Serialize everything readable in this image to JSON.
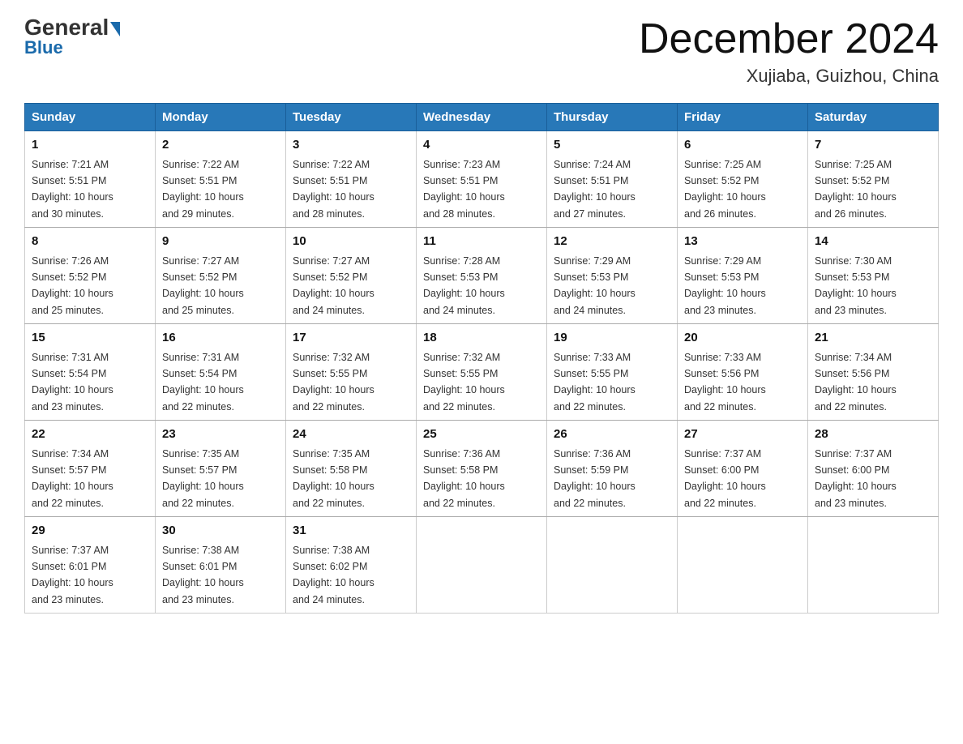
{
  "header": {
    "logo_line1": "General",
    "logo_line2": "Blue",
    "month_title": "December 2024",
    "location": "Xujiaba, Guizhou, China"
  },
  "days_of_week": [
    "Sunday",
    "Monday",
    "Tuesday",
    "Wednesday",
    "Thursday",
    "Friday",
    "Saturday"
  ],
  "weeks": [
    [
      {
        "day": "1",
        "sunrise": "7:21 AM",
        "sunset": "5:51 PM",
        "daylight": "10 hours and 30 minutes."
      },
      {
        "day": "2",
        "sunrise": "7:22 AM",
        "sunset": "5:51 PM",
        "daylight": "10 hours and 29 minutes."
      },
      {
        "day": "3",
        "sunrise": "7:22 AM",
        "sunset": "5:51 PM",
        "daylight": "10 hours and 28 minutes."
      },
      {
        "day": "4",
        "sunrise": "7:23 AM",
        "sunset": "5:51 PM",
        "daylight": "10 hours and 28 minutes."
      },
      {
        "day": "5",
        "sunrise": "7:24 AM",
        "sunset": "5:51 PM",
        "daylight": "10 hours and 27 minutes."
      },
      {
        "day": "6",
        "sunrise": "7:25 AM",
        "sunset": "5:52 PM",
        "daylight": "10 hours and 26 minutes."
      },
      {
        "day": "7",
        "sunrise": "7:25 AM",
        "sunset": "5:52 PM",
        "daylight": "10 hours and 26 minutes."
      }
    ],
    [
      {
        "day": "8",
        "sunrise": "7:26 AM",
        "sunset": "5:52 PM",
        "daylight": "10 hours and 25 minutes."
      },
      {
        "day": "9",
        "sunrise": "7:27 AM",
        "sunset": "5:52 PM",
        "daylight": "10 hours and 25 minutes."
      },
      {
        "day": "10",
        "sunrise": "7:27 AM",
        "sunset": "5:52 PM",
        "daylight": "10 hours and 24 minutes."
      },
      {
        "day": "11",
        "sunrise": "7:28 AM",
        "sunset": "5:53 PM",
        "daylight": "10 hours and 24 minutes."
      },
      {
        "day": "12",
        "sunrise": "7:29 AM",
        "sunset": "5:53 PM",
        "daylight": "10 hours and 24 minutes."
      },
      {
        "day": "13",
        "sunrise": "7:29 AM",
        "sunset": "5:53 PM",
        "daylight": "10 hours and 23 minutes."
      },
      {
        "day": "14",
        "sunrise": "7:30 AM",
        "sunset": "5:53 PM",
        "daylight": "10 hours and 23 minutes."
      }
    ],
    [
      {
        "day": "15",
        "sunrise": "7:31 AM",
        "sunset": "5:54 PM",
        "daylight": "10 hours and 23 minutes."
      },
      {
        "day": "16",
        "sunrise": "7:31 AM",
        "sunset": "5:54 PM",
        "daylight": "10 hours and 22 minutes."
      },
      {
        "day": "17",
        "sunrise": "7:32 AM",
        "sunset": "5:55 PM",
        "daylight": "10 hours and 22 minutes."
      },
      {
        "day": "18",
        "sunrise": "7:32 AM",
        "sunset": "5:55 PM",
        "daylight": "10 hours and 22 minutes."
      },
      {
        "day": "19",
        "sunrise": "7:33 AM",
        "sunset": "5:55 PM",
        "daylight": "10 hours and 22 minutes."
      },
      {
        "day": "20",
        "sunrise": "7:33 AM",
        "sunset": "5:56 PM",
        "daylight": "10 hours and 22 minutes."
      },
      {
        "day": "21",
        "sunrise": "7:34 AM",
        "sunset": "5:56 PM",
        "daylight": "10 hours and 22 minutes."
      }
    ],
    [
      {
        "day": "22",
        "sunrise": "7:34 AM",
        "sunset": "5:57 PM",
        "daylight": "10 hours and 22 minutes."
      },
      {
        "day": "23",
        "sunrise": "7:35 AM",
        "sunset": "5:57 PM",
        "daylight": "10 hours and 22 minutes."
      },
      {
        "day": "24",
        "sunrise": "7:35 AM",
        "sunset": "5:58 PM",
        "daylight": "10 hours and 22 minutes."
      },
      {
        "day": "25",
        "sunrise": "7:36 AM",
        "sunset": "5:58 PM",
        "daylight": "10 hours and 22 minutes."
      },
      {
        "day": "26",
        "sunrise": "7:36 AM",
        "sunset": "5:59 PM",
        "daylight": "10 hours and 22 minutes."
      },
      {
        "day": "27",
        "sunrise": "7:37 AM",
        "sunset": "6:00 PM",
        "daylight": "10 hours and 22 minutes."
      },
      {
        "day": "28",
        "sunrise": "7:37 AM",
        "sunset": "6:00 PM",
        "daylight": "10 hours and 23 minutes."
      }
    ],
    [
      {
        "day": "29",
        "sunrise": "7:37 AM",
        "sunset": "6:01 PM",
        "daylight": "10 hours and 23 minutes."
      },
      {
        "day": "30",
        "sunrise": "7:38 AM",
        "sunset": "6:01 PM",
        "daylight": "10 hours and 23 minutes."
      },
      {
        "day": "31",
        "sunrise": "7:38 AM",
        "sunset": "6:02 PM",
        "daylight": "10 hours and 24 minutes."
      },
      null,
      null,
      null,
      null
    ]
  ],
  "labels": {
    "sunrise": "Sunrise:",
    "sunset": "Sunset:",
    "daylight": "Daylight:"
  }
}
